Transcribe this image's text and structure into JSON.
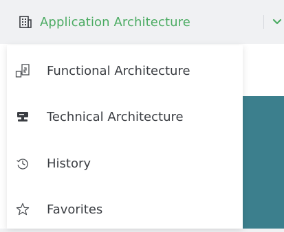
{
  "header": {
    "app_menu_label": "Application Architecture",
    "app_menu_icon": "building-icon",
    "accent_color": "#4bab62",
    "dropdown_indicator_icon": "chevron-down-icon"
  },
  "menu": {
    "items": [
      {
        "label": "Functional Architecture",
        "icon": "functional-diagram-icon"
      },
      {
        "label": "Technical Architecture",
        "icon": "server-icon"
      },
      {
        "label": "History",
        "icon": "history-icon"
      },
      {
        "label": "Favorites",
        "icon": "star-icon"
      }
    ]
  }
}
